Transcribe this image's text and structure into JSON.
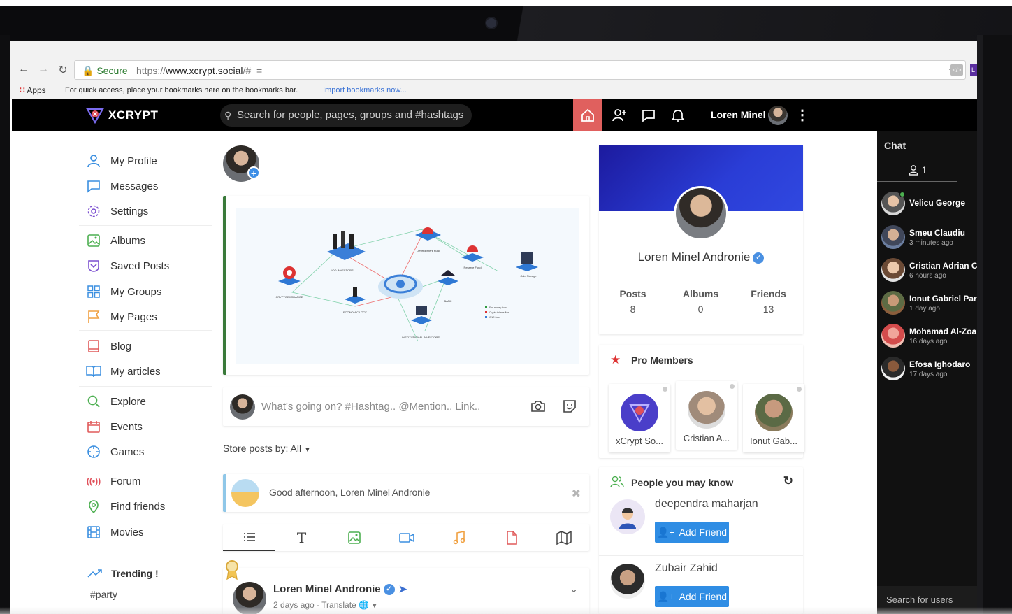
{
  "browser": {
    "secure_label": "Secure",
    "url_scheme": "https://",
    "url_host": "www.xcrypt.social",
    "url_path": "/#_=_",
    "apps_label": "Apps",
    "bookmarks_hint": "For quick access, place your bookmarks here on the bookmarks bar.",
    "import_link": "Import bookmarks now..."
  },
  "header": {
    "logo_text": "XCRYPT",
    "search_placeholder": "Search for people, pages, groups and #hashtags",
    "user_name": "Loren Minel",
    "accent_color": "#e0605e"
  },
  "sidebar": {
    "items": [
      {
        "label": "My Profile",
        "icon": "user-icon"
      },
      {
        "label": "Messages",
        "icon": "message-icon"
      },
      {
        "label": "Settings",
        "icon": "gear-icon"
      },
      {
        "label": "Albums",
        "icon": "image-icon"
      },
      {
        "label": "Saved Posts",
        "icon": "bookmark-icon"
      },
      {
        "label": "My Groups",
        "icon": "grid-icon"
      },
      {
        "label": "My Pages",
        "icon": "flag-icon"
      },
      {
        "label": "Blog",
        "icon": "blog-icon"
      },
      {
        "label": "My articles",
        "icon": "book-icon"
      },
      {
        "label": "Explore",
        "icon": "search-icon"
      },
      {
        "label": "Events",
        "icon": "calendar-icon"
      },
      {
        "label": "Games",
        "icon": "crosshair-icon"
      },
      {
        "label": "Forum",
        "icon": "broadcast-icon"
      },
      {
        "label": "Find friends",
        "icon": "location-icon"
      },
      {
        "label": "Movies",
        "icon": "film-icon"
      }
    ],
    "trending_label": "Trending !",
    "trending_tag": "#party"
  },
  "feed": {
    "composer_placeholder": "What's going on? #Hashtag.. @Mention.. Link..",
    "filter_label": "Store posts by: All",
    "greeting": "Good afternoon, Loren Minel Andronie",
    "post": {
      "author": "Loren Minel Andronie",
      "meta": "2 days ago - Translate"
    },
    "promo_labels": {
      "ico_investors": "ICO INVESTORS",
      "development_fund": "Development Fund",
      "reserve_fund": "Reserve Fund",
      "cold_storage": "Cold Storage",
      "crypto_exchange": "CRYPTOEXCHANGE",
      "economic_lock": "ECONOMIC LOCK",
      "bank": "BANK",
      "institutional": "INSTITUTIONAL INVESTORS",
      "legend_1": "Fiat money flow",
      "legend_2": "Crypto tokens flow",
      "legend_3": "CNC flow"
    }
  },
  "profile": {
    "name": "Loren Minel Andronie",
    "stats": [
      {
        "label": "Posts",
        "value": "8"
      },
      {
        "label": "Albums",
        "value": "0"
      },
      {
        "label": "Friends",
        "value": "13"
      }
    ]
  },
  "pro_members": {
    "title": "Pro Members",
    "members": [
      {
        "name": "xCrypt So..."
      },
      {
        "name": "Cristian A..."
      },
      {
        "name": "Ionut Gab..."
      }
    ]
  },
  "people_you_may_know": {
    "title": "People you may know",
    "people": [
      {
        "name": "deependra maharjan",
        "button": "Add Friend"
      },
      {
        "name": "Zubair Zahid",
        "button": "Add Friend"
      }
    ]
  },
  "chat": {
    "title": "Chat",
    "online_count": "1",
    "users": [
      {
        "name": "Velicu George",
        "time": ""
      },
      {
        "name": "Smeu Claudiu",
        "time": "3 minutes ago"
      },
      {
        "name": "Cristian Adrian C",
        "time": "6 hours ago"
      },
      {
        "name": "Ionut Gabriel Par",
        "time": "1 day ago"
      },
      {
        "name": "Mohamad Al-Zoa",
        "time": "16 days ago"
      },
      {
        "name": "Efosa Ighodaro",
        "time": "17 days ago"
      }
    ],
    "search_placeholder": "Search for users"
  }
}
